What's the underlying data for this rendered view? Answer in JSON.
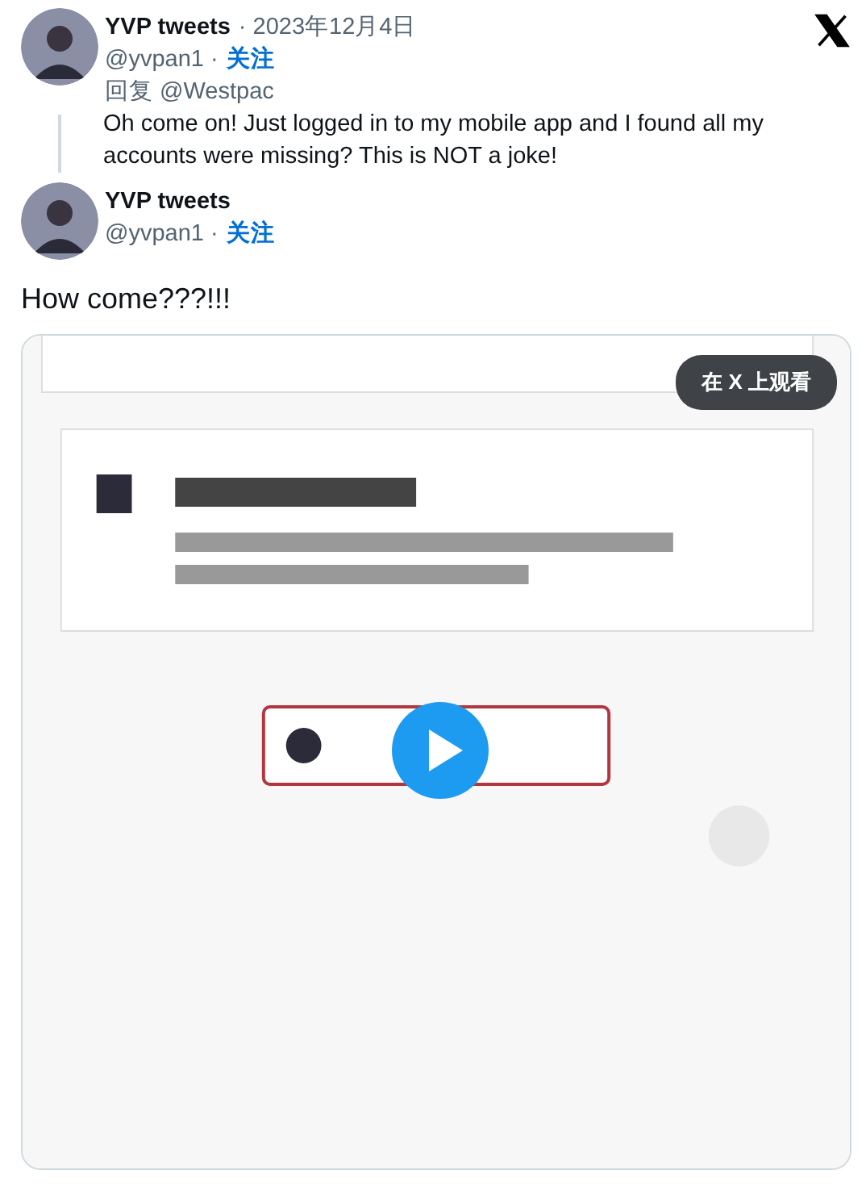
{
  "reply_tweet": {
    "author": "YVP tweets",
    "date": "· 2023年12月4日",
    "handle": "@yvpan1 ·",
    "follow": "关注",
    "reply_to": "回复 @Westpac",
    "text": "Oh come on! Just logged in to my mobile app and I found all my accounts were missing? This is NOT a joke!"
  },
  "main_tweet": {
    "author": "YVP tweets",
    "handle": "@yvpan1 ·",
    "follow": "关注",
    "text": "How come???!!!"
  },
  "video": {
    "kind": "picture",
    "watch_button": "在 X 上观看"
  }
}
